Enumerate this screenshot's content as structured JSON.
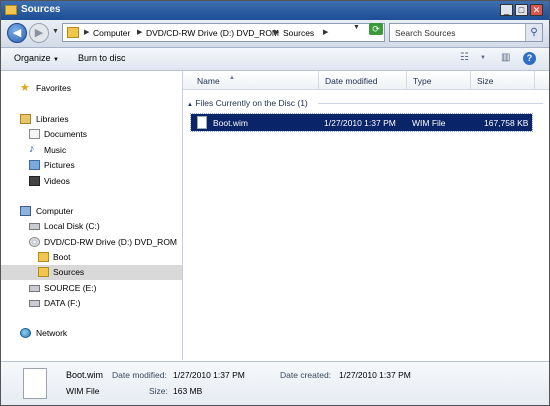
{
  "window": {
    "title": "Sources"
  },
  "address_bar": {
    "crumbs": [
      "Computer",
      "DVD/CD-RW Drive (D:) DVD_ROM",
      "Sources"
    ],
    "search_placeholder": "Search Sources"
  },
  "toolbar": {
    "organize_label": "Organize",
    "burn_label": "Burn to disc"
  },
  "nav_pane": {
    "favorites": "Favorites",
    "libraries": "Libraries",
    "documents": "Documents",
    "music": "Music",
    "pictures": "Pictures",
    "videos": "Videos",
    "computer": "Computer",
    "local_disk": "Local Disk (C:)",
    "dvd_drive": "DVD/CD-RW Drive (D:) DVD_ROM",
    "boot_folder": "Boot",
    "sources_folder": "Sources",
    "source_drive": "SOURCE (E:)",
    "data_drive": "DATA (F:)",
    "network": "Network"
  },
  "columns": {
    "name": "Name",
    "date_modified": "Date modified",
    "type": "Type",
    "size": "Size"
  },
  "group": {
    "label": "Files Currently on the Disc (1)"
  },
  "files": [
    {
      "name": "Boot.wim",
      "date_modified": "1/27/2010 1:37 PM",
      "type": "WIM File",
      "size": "167,758 KB",
      "selected": true
    }
  ],
  "details": {
    "name": "Boot.wim",
    "type": "WIM File",
    "date_modified_label": "Date modified:",
    "date_modified": "1/27/2010 1:37 PM",
    "date_created_label": "Date created:",
    "date_created": "1/27/2010 1:37 PM",
    "size_label": "Size:",
    "size": "163 MB"
  },
  "colors": {
    "title_bar": "#1d4d94",
    "selection": "#0a2469",
    "nav_selected": "#d9d9d9"
  },
  "icons": [
    "back-arrow-icon",
    "forward-arrow-icon",
    "folder-icon",
    "refresh-icon",
    "search-icon",
    "views-icon",
    "preview-pane-icon",
    "help-icon",
    "star-icon",
    "library-icon",
    "computer-icon",
    "disk-icon",
    "dvd-icon",
    "network-icon",
    "file-icon"
  ]
}
